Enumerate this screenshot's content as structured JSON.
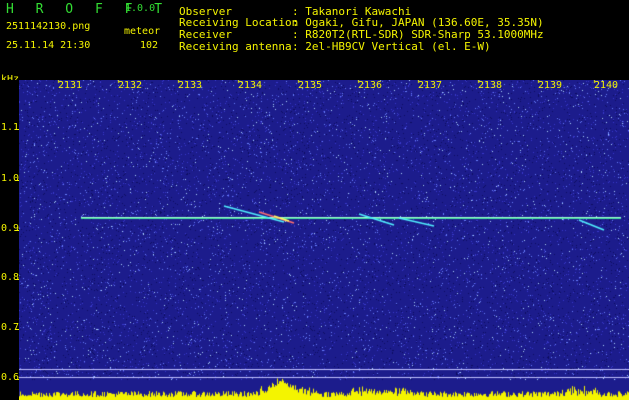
{
  "app": {
    "name": "H R O F F T",
    "version": "1.0.0"
  },
  "file": {
    "name": "2511142130.png",
    "datetime": "25.11.14 21:30"
  },
  "meteor": {
    "label": "meteor",
    "count": "102"
  },
  "info": {
    "observer_label": "Observer",
    "observer_value": ": Takanori Kawachi",
    "location_label": "Receiving Location",
    "location_value": ": Ogaki, Gifu, JAPAN (136.60E, 35.35N)",
    "receiver_label": "Receiver",
    "receiver_value": ": R820T2(RTL-SDR) SDR-Sharp 53.1000MHz",
    "antenna_label": "Receiving antenna",
    "antenna_value": ": 2el-HB9CV Vertical (el. E-W)"
  },
  "axis": {
    "unit": "kHz",
    "time_ticks": [
      "2131",
      "2132",
      "2133",
      "2134",
      "2135",
      "2136",
      "2137",
      "2138",
      "2139",
      "2140"
    ],
    "freq_ticks": [
      "1.1",
      "1.0",
      "0.9",
      "0.8",
      "0.7",
      "0.6"
    ]
  },
  "colors": {
    "background": "#000000",
    "text": "#f4f400",
    "title": "#33dd33",
    "spectrogram": "#1c1c8c",
    "carrier": "#40e0a0"
  }
}
